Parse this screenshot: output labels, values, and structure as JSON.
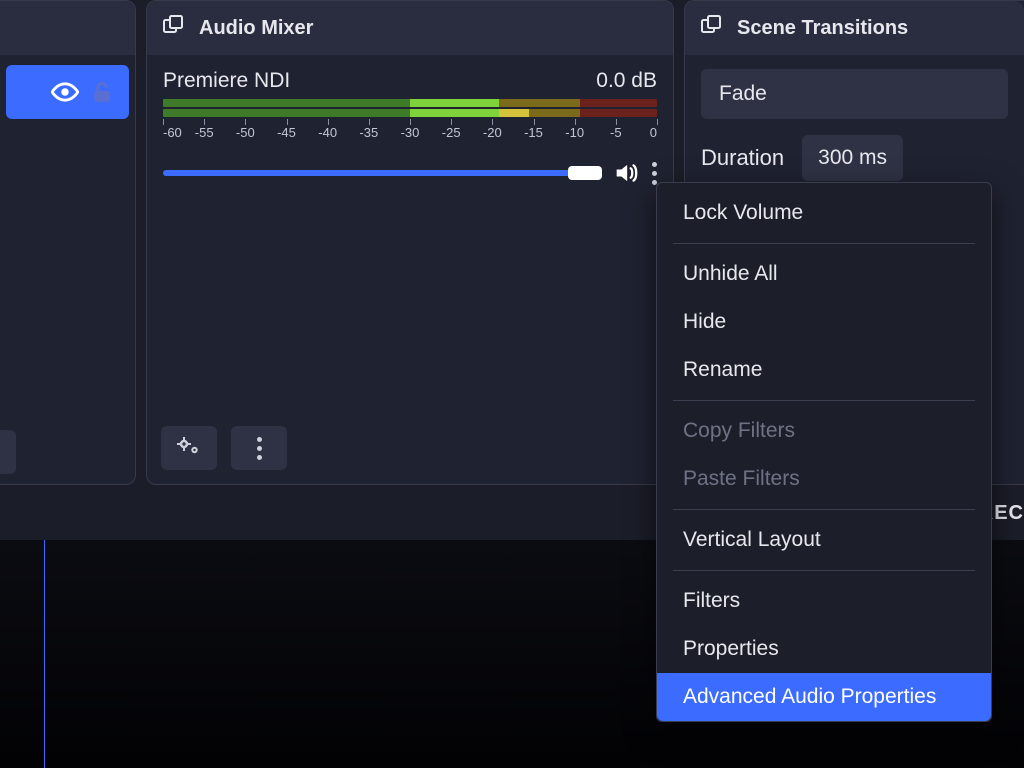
{
  "left_panel": {
    "visible_icon": "eye-icon",
    "lock_icon": "lock-icon"
  },
  "audio_mixer": {
    "title": "Audio Mixer",
    "channel": {
      "name": "Premiere NDI",
      "db_readout": "0.0 dB",
      "scale_labels": [
        "-60",
        "-55",
        "-50",
        "-45",
        "-40",
        "-35",
        "-30",
        "-25",
        "-20",
        "-15",
        "-10",
        "-5",
        "0"
      ]
    }
  },
  "scene_transitions": {
    "title": "Scene Transitions",
    "selected": "Fade",
    "duration_label": "Duration",
    "duration_value": "300 ms"
  },
  "context_menu": {
    "items": [
      {
        "label": "Lock Volume",
        "disabled": false
      },
      {
        "sep": true
      },
      {
        "label": "Unhide All",
        "disabled": false
      },
      {
        "label": "Hide",
        "disabled": false
      },
      {
        "label": "Rename",
        "disabled": false
      },
      {
        "sep": true
      },
      {
        "label": "Copy Filters",
        "disabled": true
      },
      {
        "label": "Paste Filters",
        "disabled": true
      },
      {
        "sep": true
      },
      {
        "label": "Vertical Layout",
        "disabled": false
      },
      {
        "sep": true
      },
      {
        "label": "Filters",
        "disabled": false
      },
      {
        "label": "Properties",
        "disabled": false
      },
      {
        "label": "Advanced Audio Properties",
        "disabled": false,
        "highlight": true
      }
    ]
  },
  "edge": {
    "right_text": "REC"
  }
}
